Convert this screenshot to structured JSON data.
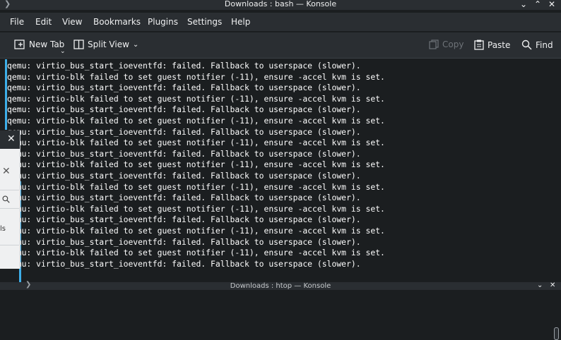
{
  "window": {
    "title": "Downloads : bash — Konsole"
  },
  "menu": [
    "File",
    "Edit",
    "View",
    "Bookmarks",
    "Plugins",
    "Settings",
    "Help"
  ],
  "toolbar": {
    "new_tab": "New Tab",
    "split_view": "Split View",
    "copy": "Copy",
    "paste": "Paste",
    "find": "Find"
  },
  "terminal": {
    "lines": [
      "qemu: virtio_bus_start_ioeventfd: failed. Fallback to userspace (slower).",
      "qemu: virtio-blk failed to set guest notifier (-11), ensure -accel kvm is set.",
      "qemu: virtio_bus_start_ioeventfd: failed. Fallback to userspace (slower).",
      "qemu: virtio-blk failed to set guest notifier (-11), ensure -accel kvm is set.",
      "qemu: virtio_bus_start_ioeventfd: failed. Fallback to userspace (slower).",
      "qemu: virtio-blk failed to set guest notifier (-11), ensure -accel kvm is set.",
      "qemu: virtio_bus_start_ioeventfd: failed. Fallback to userspace (slower).",
      "qemu: virtio-blk failed to set guest notifier (-11), ensure -accel kvm is set.",
      "qemu: virtio_bus_start_ioeventfd: failed. Fallback to userspace (slower).",
      "qemu: virtio-blk failed to set guest notifier (-11), ensure -accel kvm is set.",
      "qemu: virtio_bus_start_ioeventfd: failed. Fallback to userspace (slower).",
      "qemu: virtio-blk failed to set guest notifier (-11), ensure -accel kvm is set.",
      "qemu: virtio_bus_start_ioeventfd: failed. Fallback to userspace (slower).",
      "qemu: virtio-blk failed to set guest notifier (-11), ensure -accel kvm is set.",
      "qemu: virtio_bus_start_ioeventfd: failed. Fallback to userspace (slower).",
      "qemu: virtio-blk failed to set guest notifier (-11), ensure -accel kvm is set.",
      "qemu: virtio_bus_start_ioeventfd: failed. Fallback to userspace (slower).",
      "qemu: virtio-blk failed to set guest notifier (-11), ensure -accel kvm is set.",
      "qemu: virtio_bus_start_ioeventfd: failed. Fallback to userspace (slower)."
    ]
  },
  "overlay": {
    "close": "✕",
    "close2": "✕",
    "partial": "ls"
  },
  "bottom_window": {
    "title": "Downloads : htop — Konsole"
  },
  "colors": {
    "accent": "#3daee9",
    "bg": "#1b1e20",
    "chrome": "#2a2e32"
  }
}
